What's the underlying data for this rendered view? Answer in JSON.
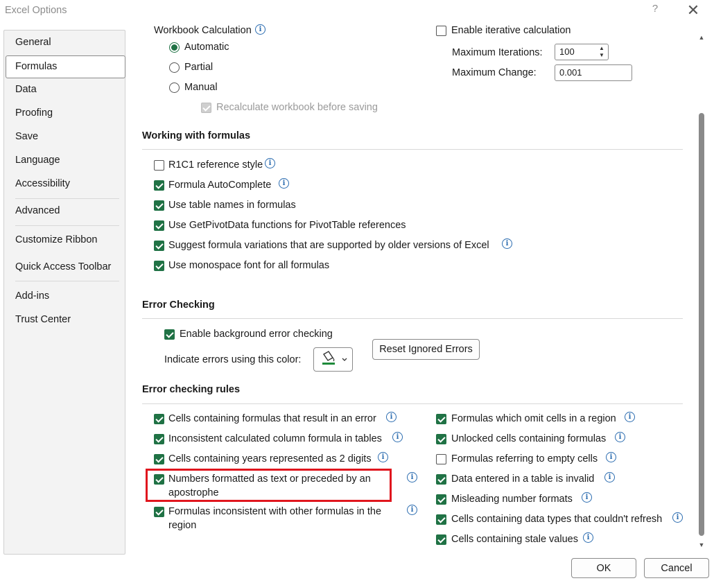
{
  "window": {
    "title": "Excel Options",
    "help_label": "?",
    "close_label": "✕"
  },
  "sidebar": {
    "items": [
      {
        "label": "General"
      },
      {
        "label": "Formulas"
      },
      {
        "label": "Data"
      },
      {
        "label": "Proofing"
      },
      {
        "label": "Save"
      },
      {
        "label": "Language"
      },
      {
        "label": "Accessibility"
      },
      {
        "label": "Advanced"
      },
      {
        "label": "Customize Ribbon"
      },
      {
        "label": "Quick Access Toolbar"
      },
      {
        "label": "Add-ins"
      },
      {
        "label": "Trust Center"
      }
    ],
    "selected": "Formulas"
  },
  "calc": {
    "partial_heading": "Workbook Calculation",
    "automatic": "Automatic",
    "partial": "Partial",
    "manual": "Manual",
    "recalc": "Recalculate workbook before saving",
    "iterative": "Enable iterative calculation",
    "max_iter_label": "Maximum Iterations:",
    "max_iter_value": "100",
    "max_change_label": "Maximum Change:",
    "max_change_value": "0.001"
  },
  "formulas": {
    "heading": "Working with formulas",
    "r1c1": "R1C1 reference style",
    "autocomplete": "Formula AutoComplete",
    "table_names": "Use table names in formulas",
    "getpivot": "Use GetPivotData functions for PivotTable references",
    "suggest": "Suggest formula variations that are supported by older versions of Excel",
    "monospace": "Use monospace font for all formulas"
  },
  "errors": {
    "heading": "Error Checking",
    "enable_bg": "Enable background error checking",
    "indicate": "Indicate errors using this color:",
    "reset_btn": "Reset Ignored Errors"
  },
  "rules": {
    "heading": "Error checking rules",
    "left": [
      "Cells containing formulas that result in an error",
      "Inconsistent calculated column formula in tables",
      "Cells containing years represented as 2 digits",
      "Numbers formatted as text or preceded by an",
      "apostrophe",
      "Formulas inconsistent with other formulas in the",
      "region"
    ],
    "right": [
      "Formulas which omit cells in a region",
      "Unlocked cells containing formulas",
      "Formulas referring to empty cells",
      "Data entered in a table is invalid",
      "Misleading number formats",
      "Cells containing data types that couldn't refresh",
      "Cells containing stale values"
    ]
  },
  "footer": {
    "ok": "OK",
    "cancel": "Cancel"
  },
  "colors": {
    "accent": "#207245",
    "highlight": "#e0161e",
    "info": "#2b6cb0"
  }
}
